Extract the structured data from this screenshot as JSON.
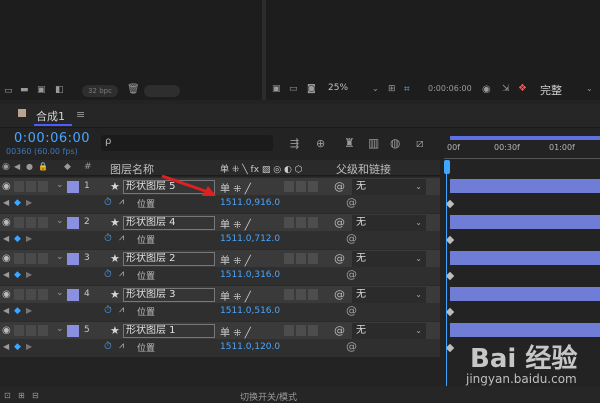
{
  "top": {
    "bpc": "32 bpc",
    "zoom": "25%",
    "timecode": "0:00:06:00",
    "resolution": "完整"
  },
  "comp": {
    "tab_title": "合成1",
    "menu_icon": "≡",
    "current_time": "0:00:06:00",
    "frame_info": "00360 (60.00 fps)",
    "search_placeholder": "",
    "search_icon_glyph": "ρ"
  },
  "columns": {
    "layer_name": "图层名称",
    "parent_link": "父级和链接",
    "number_symbol": "#"
  },
  "ruler": {
    "ticks": [
      "00f",
      "00:30f",
      "01:00f"
    ]
  },
  "layers": [
    {
      "num": "1",
      "name": "形状图层 5",
      "parent": "无",
      "prop": "位置",
      "value": "1511.0,916.0"
    },
    {
      "num": "2",
      "name": "形状图层 4",
      "parent": "无",
      "prop": "位置",
      "value": "1511.0,712.0"
    },
    {
      "num": "3",
      "name": "形状图层 2",
      "parent": "无",
      "prop": "位置",
      "value": "1511.0,316.0"
    },
    {
      "num": "4",
      "name": "形状图层 3",
      "parent": "无",
      "prop": "位置",
      "value": "1511.0,516.0"
    },
    {
      "num": "5",
      "name": "形状图层 1",
      "parent": "无",
      "prop": "位置",
      "value": "1511.0,120.0"
    }
  ],
  "footer": {
    "toggle_label": "切换开关/模式"
  },
  "watermark": {
    "logo": "Bai 经验",
    "url": "jingyan.baidu.com"
  },
  "colors": {
    "accent_blue": "#3ea6ff",
    "layer_bar": "#6f7dd6",
    "label_swatch": "#8b8fe0"
  }
}
